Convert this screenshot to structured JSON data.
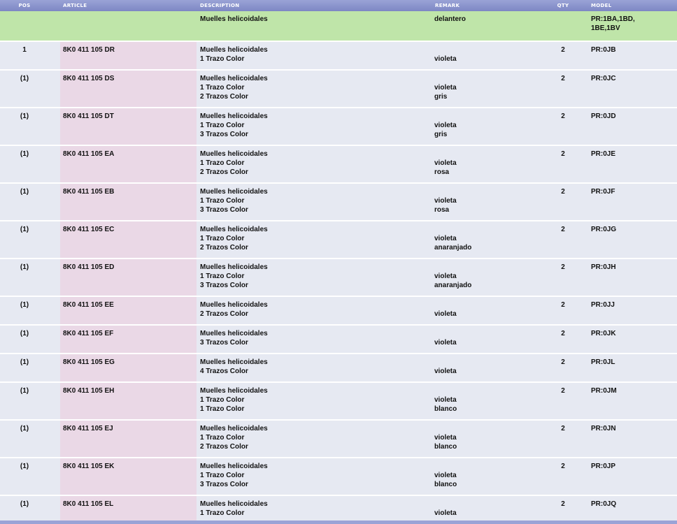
{
  "header": {
    "pos": "POS",
    "article": "ARTICLE",
    "description": "DESCRIPTION",
    "remark": "REMARK",
    "qty": "QTY",
    "model": "MODEL"
  },
  "group": {
    "description": "Muelles helicoidales",
    "remark": "delantero",
    "model_line1": "PR:1BA,1BD,",
    "model_line2": "1BE,1BV"
  },
  "rows": [
    {
      "pos": "1",
      "article": "8K0 411 105 DR",
      "desc": [
        "Muelles helicoidales",
        "1 Trazo Color"
      ],
      "remark": [
        "",
        "violeta"
      ],
      "qty": "2",
      "model": "PR:0JB"
    },
    {
      "pos": "(1)",
      "article": "8K0 411 105 DS",
      "desc": [
        "Muelles helicoidales",
        "1 Trazo Color",
        "2 Trazos Color"
      ],
      "remark": [
        "",
        "violeta",
        "gris"
      ],
      "qty": "2",
      "model": "PR:0JC"
    },
    {
      "pos": "(1)",
      "article": "8K0 411 105 DT",
      "desc": [
        "Muelles helicoidales",
        "1 Trazo Color",
        "3 Trazos Color"
      ],
      "remark": [
        "",
        "violeta",
        "gris"
      ],
      "qty": "2",
      "model": "PR:0JD"
    },
    {
      "pos": "(1)",
      "article": "8K0 411 105 EA",
      "desc": [
        "Muelles helicoidales",
        "1 Trazo Color",
        "2 Trazos Color"
      ],
      "remark": [
        "",
        "violeta",
        "rosa"
      ],
      "qty": "2",
      "model": "PR:0JE"
    },
    {
      "pos": "(1)",
      "article": "8K0 411 105 EB",
      "desc": [
        "Muelles helicoidales",
        "1 Trazo Color",
        "3 Trazos Color"
      ],
      "remark": [
        "",
        "violeta",
        "rosa"
      ],
      "qty": "2",
      "model": "PR:0JF"
    },
    {
      "pos": "(1)",
      "article": "8K0 411 105 EC",
      "desc": [
        "Muelles helicoidales",
        "1 Trazo Color",
        "2 Trazos Color"
      ],
      "remark": [
        "",
        "violeta",
        "anaranjado"
      ],
      "qty": "2",
      "model": "PR:0JG"
    },
    {
      "pos": "(1)",
      "article": "8K0 411 105 ED",
      "desc": [
        "Muelles helicoidales",
        "1 Trazo Color",
        "3 Trazos Color"
      ],
      "remark": [
        "",
        "violeta",
        "anaranjado"
      ],
      "qty": "2",
      "model": "PR:0JH"
    },
    {
      "pos": "(1)",
      "article": "8K0 411 105 EE",
      "desc": [
        "Muelles helicoidales",
        "2 Trazos Color"
      ],
      "remark": [
        "",
        "violeta"
      ],
      "qty": "2",
      "model": "PR:0JJ"
    },
    {
      "pos": "(1)",
      "article": "8K0 411 105 EF",
      "desc": [
        "Muelles helicoidales",
        "3 Trazos Color"
      ],
      "remark": [
        "",
        "violeta"
      ],
      "qty": "2",
      "model": "PR:0JK"
    },
    {
      "pos": "(1)",
      "article": "8K0 411 105 EG",
      "desc": [
        "Muelles helicoidales",
        "4 Trazos Color"
      ],
      "remark": [
        "",
        "violeta"
      ],
      "qty": "2",
      "model": "PR:0JL"
    },
    {
      "pos": "(1)",
      "article": "8K0 411 105 EH",
      "desc": [
        "Muelles helicoidales",
        "1 Trazo Color",
        "1 Trazo Color"
      ],
      "remark": [
        "",
        "violeta",
        "blanco"
      ],
      "qty": "2",
      "model": "PR:0JM"
    },
    {
      "pos": "(1)",
      "article": "8K0 411 105 EJ",
      "desc": [
        "Muelles helicoidales",
        "1 Trazo Color",
        "2 Trazos Color"
      ],
      "remark": [
        "",
        "violeta",
        "blanco"
      ],
      "qty": "2",
      "model": "PR:0JN"
    },
    {
      "pos": "(1)",
      "article": "8K0 411 105 EK",
      "desc": [
        "Muelles helicoidales",
        "1 Trazo Color",
        "3 Trazos Color"
      ],
      "remark": [
        "",
        "violeta",
        "blanco"
      ],
      "qty": "2",
      "model": "PR:0JP"
    },
    {
      "pos": "(1)",
      "article": "8K0 411 105 EL",
      "desc": [
        "Muelles helicoidales",
        "1 Trazo Color"
      ],
      "remark": [
        "",
        "violeta"
      ],
      "qty": "2",
      "model": "PR:0JQ"
    }
  ]
}
